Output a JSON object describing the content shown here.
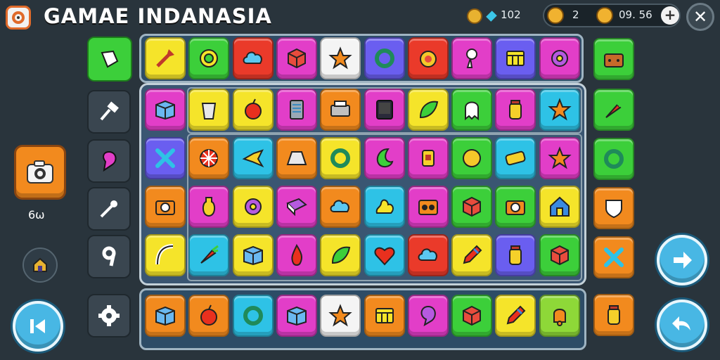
{
  "header": {
    "title": "GAMAE INDANASIA",
    "gem_count": "102",
    "currency_a": "2",
    "currency_b": "09. 56",
    "plus_label": "+",
    "close_label": "✕"
  },
  "left": {
    "camera_count": "6ω"
  },
  "colors": {
    "background": "#29343c",
    "panel": "#2d4c66",
    "board": "#3a5672",
    "accent_orange": "#f28a1e",
    "accent_blue": "#48b7e4"
  },
  "palette": {
    "o": "#f28a1e",
    "g": "#3ccf3a",
    "r": "#ea3a2a",
    "m": "#e23ec8",
    "w": "#f4f4f4",
    "c": "#2ec2e6",
    "y": "#f5e42a",
    "b": "#6a5ef0",
    "l": "#8ed838"
  },
  "top_row": [
    {
      "color": "y",
      "icon": "dart-icon"
    },
    {
      "color": "g",
      "icon": "gear-ring-icon"
    },
    {
      "color": "r",
      "icon": "cloud-icon"
    },
    {
      "color": "m",
      "icon": "cube-icon"
    },
    {
      "color": "w",
      "icon": "star-icon"
    },
    {
      "color": "b",
      "icon": "ring-icon"
    },
    {
      "color": "r",
      "icon": "medal-icon"
    },
    {
      "color": "m",
      "icon": "key-icon"
    },
    {
      "color": "b",
      "icon": "window-icon"
    },
    {
      "color": "m",
      "icon": "donut-icon"
    }
  ],
  "grid": [
    [
      {
        "color": "m",
        "icon": "box-icon"
      },
      {
        "color": "y",
        "icon": "bucket-icon"
      },
      {
        "color": "y",
        "icon": "apple-icon"
      },
      {
        "color": "m",
        "icon": "panel-icon"
      },
      {
        "color": "o",
        "icon": "printer-icon"
      },
      {
        "color": "m",
        "icon": "screen-icon"
      },
      {
        "color": "y",
        "icon": "leaf-icon"
      },
      {
        "color": "g",
        "icon": "ghost-icon"
      },
      {
        "color": "m",
        "icon": "jar-icon"
      },
      {
        "color": "c",
        "icon": "star-icon"
      }
    ],
    [
      {
        "color": "b",
        "icon": "cross-icon"
      },
      {
        "color": "o",
        "icon": "wheel-icon"
      },
      {
        "color": "c",
        "icon": "bird-icon"
      },
      {
        "color": "o",
        "icon": "trapezoid-icon"
      },
      {
        "color": "y",
        "icon": "ring-icon"
      },
      {
        "color": "m",
        "icon": "moon-icon"
      },
      {
        "color": "m",
        "icon": "lantern-icon"
      },
      {
        "color": "g",
        "icon": "coin-icon"
      },
      {
        "color": "c",
        "icon": "bar-icon"
      },
      {
        "color": "m",
        "icon": "star-icon"
      }
    ],
    [
      {
        "color": "o",
        "icon": "camera-icon"
      },
      {
        "color": "m",
        "icon": "bottle-icon"
      },
      {
        "color": "y",
        "icon": "donut-icon"
      },
      {
        "color": "m",
        "icon": "book-icon"
      },
      {
        "color": "o",
        "icon": "cloud-icon"
      },
      {
        "color": "c",
        "icon": "splash-icon"
      },
      {
        "color": "m",
        "icon": "radio-icon"
      },
      {
        "color": "g",
        "icon": "cube-icon"
      },
      {
        "color": "g",
        "icon": "camera-icon"
      },
      {
        "color": "y",
        "icon": "house-icon"
      }
    ],
    [
      {
        "color": "y",
        "icon": "arch-icon"
      },
      {
        "color": "c",
        "icon": "carrot-icon"
      },
      {
        "color": "y",
        "icon": "box-icon"
      },
      {
        "color": "m",
        "icon": "flame-icon"
      },
      {
        "color": "y",
        "icon": "leaf-icon"
      },
      {
        "color": "c",
        "icon": "heart-icon"
      },
      {
        "color": "r",
        "icon": "cloud-icon"
      },
      {
        "color": "y",
        "icon": "pencil-icon"
      },
      {
        "color": "b",
        "icon": "jar-icon"
      },
      {
        "color": "g",
        "icon": "cube-icon"
      }
    ]
  ],
  "bottom_row": [
    {
      "color": "o",
      "icon": "box-icon"
    },
    {
      "color": "o",
      "icon": "apple-icon"
    },
    {
      "color": "c",
      "icon": "ring-icon"
    },
    {
      "color": "m",
      "icon": "box-icon"
    },
    {
      "color": "w",
      "icon": "star-icon"
    },
    {
      "color": "o",
      "icon": "window-icon"
    },
    {
      "color": "m",
      "icon": "bubble-icon"
    },
    {
      "color": "g",
      "icon": "cube-icon"
    },
    {
      "color": "y",
      "icon": "pencil-icon"
    },
    {
      "color": "l",
      "icon": "bell-icon"
    }
  ],
  "right_column": [
    {
      "color": "g",
      "icon": "chest-icon"
    },
    {
      "color": "g",
      "icon": "carrot-icon"
    },
    {
      "color": "g",
      "icon": "ring-icon"
    },
    {
      "color": "o",
      "icon": "shield-icon"
    },
    {
      "color": "o",
      "icon": "cross-icon"
    },
    {
      "color": "o",
      "icon": "jar-icon"
    }
  ]
}
